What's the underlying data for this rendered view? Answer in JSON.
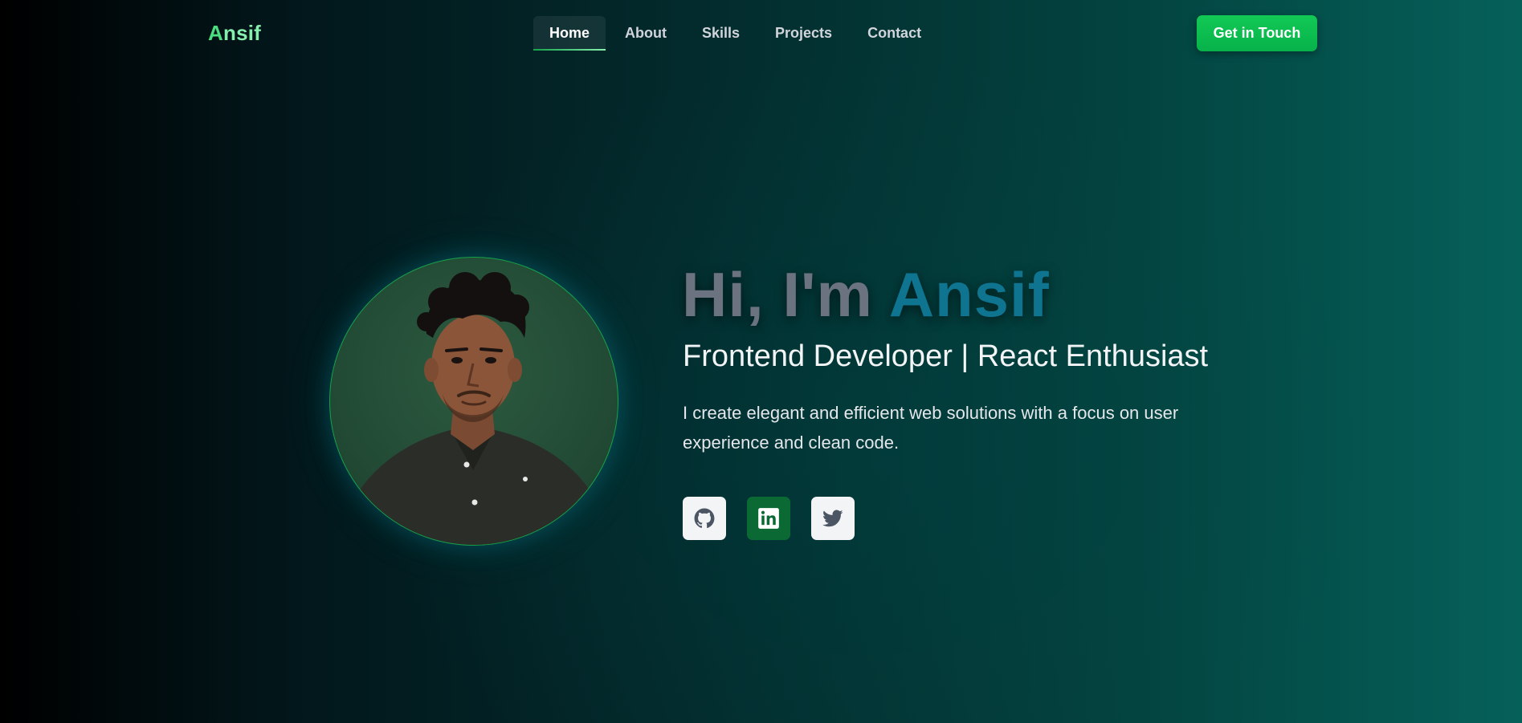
{
  "nav": {
    "logo": {
      "first_letter": "A",
      "rest": "nsif"
    },
    "items": [
      {
        "label": "Home",
        "active": true
      },
      {
        "label": "About",
        "active": false
      },
      {
        "label": "Skills",
        "active": false
      },
      {
        "label": "Projects",
        "active": false
      },
      {
        "label": "Contact",
        "active": false
      }
    ],
    "cta_label": "Get in Touch"
  },
  "hero": {
    "greeting": "Hi, I'm ",
    "name": "Ansif",
    "subtitle": "Frontend Developer | React Enthusiast",
    "description": "I create elegant and efficient web solutions with a focus on user experience and clean code.",
    "socials": [
      {
        "icon": "github-icon"
      },
      {
        "icon": "linkedin-icon"
      },
      {
        "icon": "twitter-icon"
      }
    ]
  },
  "colors": {
    "accent_green": "#12c955",
    "name_teal": "#0e7490",
    "greeting_gray": "#6b7280",
    "linkedin_bg": "#0b6a34"
  }
}
